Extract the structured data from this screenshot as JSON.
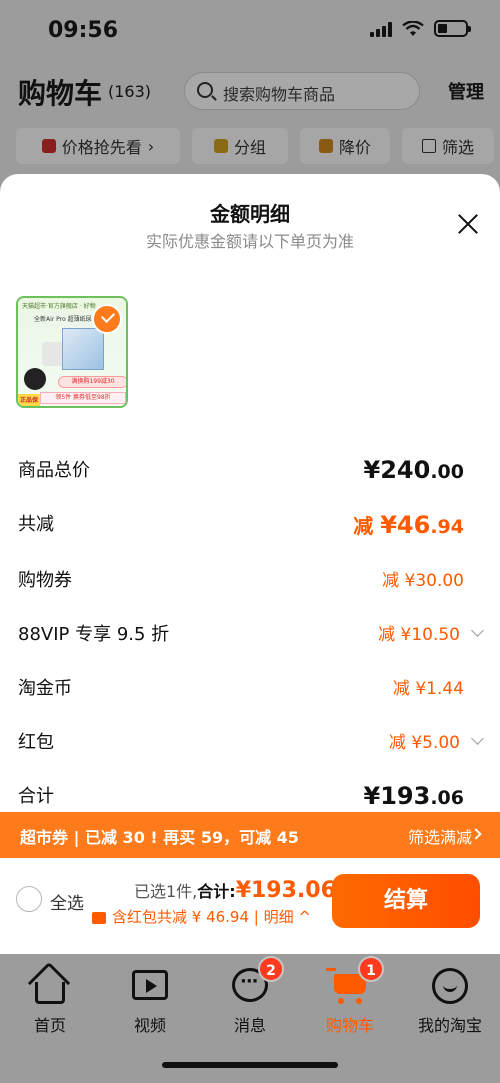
{
  "status_bar": {
    "time": "09:56"
  },
  "header": {
    "title": "购物车",
    "count": "(163)",
    "search_placeholder": "搜索购物车商品",
    "manage_label": "管理"
  },
  "filters": [
    {
      "label": "价格抢先看",
      "icon": "price-tag-icon"
    },
    {
      "label": "分组",
      "icon": "folder-icon"
    },
    {
      "label": "降价",
      "icon": "price-drop-icon"
    },
    {
      "label": "筛选",
      "icon": "filter-icon"
    }
  ],
  "sheet": {
    "title": "金额明细",
    "subtitle": "实际优惠金额请以下单页为准",
    "product": {
      "header_text": "天猫超市·官方旗舰店 · 好物",
      "name_text": "全新Air Pro 超薄纸尿裤",
      "promo1": "满换购199减30",
      "promo2": "领5件 换券低至98折",
      "badge": "正品保障"
    },
    "rows": [
      {
        "label": "商品总价",
        "prefix": "",
        "amount": "¥240",
        "decimals": ".00",
        "style": "black"
      },
      {
        "label": "共减",
        "prefix": "减 ",
        "amount": "¥46",
        "decimals": ".94",
        "style": "orange-big"
      },
      {
        "label": "购物券",
        "prefix": "减 ",
        "amount": "¥30",
        "decimals": ".00",
        "style": "orange"
      },
      {
        "label": "88VIP 专享 9.5 折",
        "prefix": "减 ",
        "amount": "¥10",
        "decimals": ".50",
        "style": "orange",
        "expandable": true
      },
      {
        "label": "淘金币",
        "prefix": "减 ",
        "amount": "¥1",
        "decimals": ".44",
        "style": "orange"
      },
      {
        "label": "红包",
        "prefix": "减 ",
        "amount": "¥5",
        "decimals": ".00",
        "style": "orange",
        "expandable": true
      },
      {
        "label": "合计",
        "prefix": "",
        "amount": "¥193",
        "decimals": ".06",
        "style": "black"
      }
    ]
  },
  "promo_strip": {
    "left_text": "超市券 | 已减 30 ! 再买 59，可减 45",
    "right_text": "筛选满减"
  },
  "checkout": {
    "select_all": "全选",
    "selected_text": "已选1件,",
    "total_label": "合计:",
    "total_price": "¥193.06",
    "discount_text": "含红包共减 ¥ 46.94",
    "detail_link": "明细 ^",
    "pay_button": "结算"
  },
  "tabbar": [
    {
      "label": "首页",
      "icon": "home-icon"
    },
    {
      "label": "视频",
      "icon": "video-icon"
    },
    {
      "label": "消息",
      "icon": "message-icon",
      "badge": "2"
    },
    {
      "label": "购物车",
      "icon": "cart-icon",
      "badge": "1",
      "active": true
    },
    {
      "label": "我的淘宝",
      "icon": "profile-smile-icon"
    }
  ],
  "colors": {
    "accent": "#ff5a00",
    "promo_strip": "#ff7a1a",
    "overlay_bg": "#9c9c9c"
  }
}
